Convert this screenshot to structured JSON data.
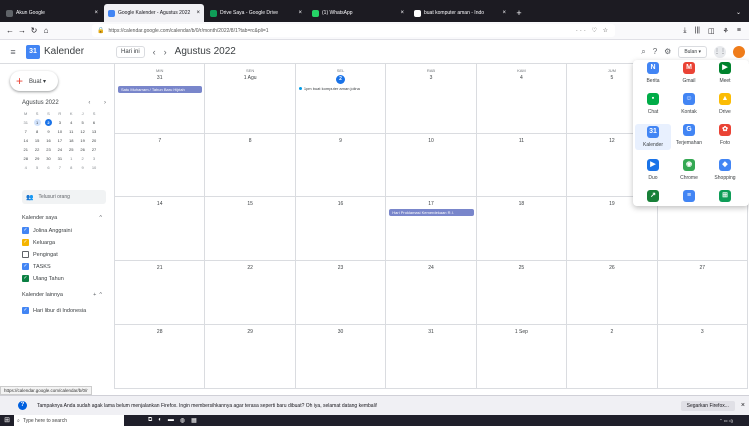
{
  "browser": {
    "tabs": [
      {
        "label": "Akun Google",
        "color": "#5f6368",
        "active": false
      },
      {
        "label": "Google Kalender - Agustus 2022",
        "color": "#4285f4",
        "active": true
      },
      {
        "label": "Drive Saya - Google Drive",
        "color": "#0f9d58",
        "active": false
      },
      {
        "label": "(1) WhatsApp",
        "color": "#25d366",
        "active": false
      },
      {
        "label": "buat komputer aman - Indo",
        "color": "#ffffff",
        "active": false
      }
    ],
    "new_tab": "+",
    "url": "https://calendar.google.com/calendar/b/0/r/month/2022/8/1?tab=rc&pli=1"
  },
  "app": {
    "name": "Kalender",
    "logo_text": "31",
    "today_button": "Hari ini",
    "month_title": "Agustus 2022",
    "view_button": "Bulan ▾"
  },
  "sidebar": {
    "create_label": "Buat ▾",
    "mini_title": "Agustus 2022",
    "mini_nav": "‹ ›",
    "mini_headers": [
      "M",
      "S",
      "S",
      "R",
      "K",
      "J",
      "S"
    ],
    "mini_days": [
      [
        "31",
        "1",
        "2",
        "3",
        "4",
        "5",
        "6"
      ],
      [
        "7",
        "8",
        "9",
        "10",
        "11",
        "12",
        "13"
      ],
      [
        "14",
        "15",
        "16",
        "17",
        "18",
        "19",
        "20"
      ],
      [
        "21",
        "22",
        "23",
        "24",
        "25",
        "26",
        "27"
      ],
      [
        "28",
        "29",
        "30",
        "31",
        "1",
        "2",
        "3"
      ],
      [
        "4",
        "5",
        "6",
        "7",
        "8",
        "9",
        "10"
      ]
    ],
    "search_people": "Telusuri orang",
    "my_calendars_title": "Kalender saya",
    "my_calendars": [
      {
        "label": "Jolina Anggraini",
        "color": "#4285f4",
        "checked": true
      },
      {
        "label": "Keluarga",
        "color": "#f4b400",
        "checked": true
      },
      {
        "label": "Pengingat",
        "color": "#5f6368",
        "checked": false
      },
      {
        "label": "TASKS",
        "color": "#4285f4",
        "checked": true
      },
      {
        "label": "Ulang Tahun",
        "color": "#0b8043",
        "checked": true
      }
    ],
    "other_calendars_title": "Kalender lainnya",
    "other_calendars": [
      {
        "label": "Hari libur di Indonesia",
        "color": "#4285f4",
        "checked": true
      }
    ]
  },
  "calendar": {
    "weekdays": [
      "MIN",
      "SEN",
      "SEL",
      "RAB",
      "KAM",
      "JUM",
      "SAB"
    ],
    "weeks": [
      [
        "31",
        "1 Agu",
        "2",
        "3",
        "4",
        "5",
        "6"
      ],
      [
        "7",
        "8",
        "9",
        "10",
        "11",
        "12",
        "13"
      ],
      [
        "14",
        "15",
        "16",
        "17",
        "18",
        "19",
        "20"
      ],
      [
        "21",
        "22",
        "23",
        "24",
        "25",
        "26",
        "27"
      ],
      [
        "28",
        "29",
        "30",
        "31",
        "1 Sep",
        "2",
        "3"
      ]
    ],
    "events": [
      {
        "label": "Satu Muharram / Tahun Baru Hijriah",
        "week": 0,
        "day": 0,
        "type": "bar"
      },
      {
        "label": "1pm buat komputer aman jolina",
        "week": 0,
        "day": 2,
        "type": "dot"
      },
      {
        "label": "Hari Proklamasi Kemerdekaan R.I.",
        "week": 2,
        "day": 3,
        "type": "bar"
      }
    ]
  },
  "apps_panel": {
    "items": [
      {
        "label": "Berita",
        "icon": "news-icon",
        "color": "#4285f4",
        "glyph": "N"
      },
      {
        "label": "Gmail",
        "icon": "gmail-icon",
        "color": "#ea4335",
        "glyph": "M"
      },
      {
        "label": "Meet",
        "icon": "meet-icon",
        "color": "#00832d",
        "glyph": "▶"
      },
      {
        "label": "Chat",
        "icon": "chat-icon",
        "color": "#00ac47",
        "glyph": "▪"
      },
      {
        "label": "Kontak",
        "icon": "contacts-icon",
        "color": "#4285f4",
        "glyph": "☺"
      },
      {
        "label": "Drive",
        "icon": "drive-icon",
        "color": "#fbbc04",
        "glyph": "▲"
      },
      {
        "label": "Kalender",
        "icon": "calendar-icon",
        "color": "#4285f4",
        "glyph": "31"
      },
      {
        "label": "Terjemahan",
        "icon": "translate-icon",
        "color": "#4285f4",
        "glyph": "G"
      },
      {
        "label": "Foto",
        "icon": "photos-icon",
        "color": "#ea4335",
        "glyph": "✿"
      },
      {
        "label": "Duo",
        "icon": "duo-icon",
        "color": "#1a73e8",
        "glyph": "▶"
      },
      {
        "label": "Chrome",
        "icon": "chrome-icon",
        "color": "#34a853",
        "glyph": "◉"
      },
      {
        "label": "Shopping",
        "icon": "shopping-icon",
        "color": "#4285f4",
        "glyph": "◆"
      },
      {
        "label": "",
        "icon": "finance-icon",
        "color": "#188038",
        "glyph": "↗"
      },
      {
        "label": "",
        "icon": "docs-icon",
        "color": "#4285f4",
        "glyph": "≡"
      },
      {
        "label": "",
        "icon": "sheets-icon",
        "color": "#0f9d58",
        "glyph": "⊞"
      }
    ],
    "highlighted": "Kalender"
  },
  "status_url": "https://calendar.google.com/calendar/b/0/r",
  "notification": {
    "text": "Tampaknya Anda sudah agak lama belum menjalankan Firefox. Ingin membersihkannya agar terasa seperti baru dibuat? Oh iya, selamat datang kembali!",
    "button": "Segarkan Firefox...",
    "close": "×"
  },
  "taskbar": {
    "search_placeholder": "Type here to search"
  }
}
